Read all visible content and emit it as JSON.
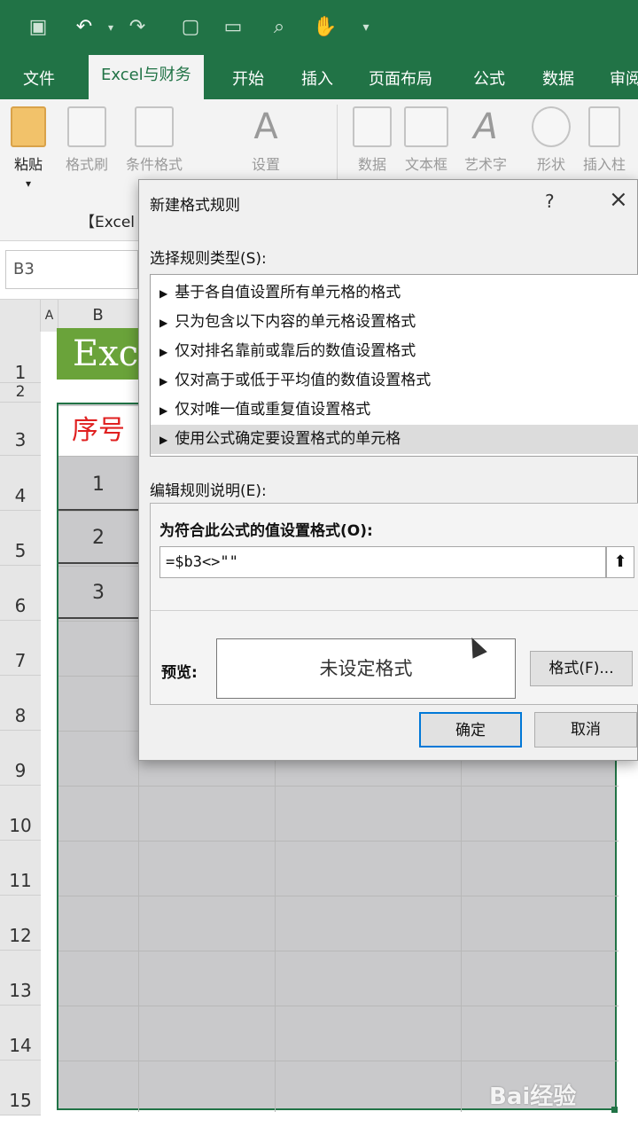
{
  "ribbon_tabs": [
    "文件",
    "Excel与财务",
    "开始",
    "插入",
    "页面布局",
    "公式",
    "数据",
    "审阅"
  ],
  "ribbon_buttons": {
    "paste": "粘贴",
    "format_painter": "格式刷",
    "conditional_format": "条件格式",
    "settings": "设置",
    "data": "数据",
    "textbox": "文本框",
    "wordart": "艺术字",
    "shapes": "形状",
    "insert_column": "插入柱",
    "group_label": "【Excel"
  },
  "name_box": "B3",
  "column_headers": [
    "A",
    "B"
  ],
  "row_headers": [
    "1",
    "2",
    "3",
    "4",
    "5",
    "6",
    "7",
    "8",
    "9",
    "10",
    "11",
    "12",
    "13",
    "14",
    "15"
  ],
  "sheet": {
    "title_cell": "Exc",
    "header_cell": "序号",
    "numbers": [
      "1",
      "2",
      "3"
    ]
  },
  "dialog": {
    "title": "新建格式规则",
    "help": "?",
    "close": "×",
    "select_rule_label": "选择规则类型(S):",
    "rules": [
      "基于各自值设置所有单元格的格式",
      "只为包含以下内容的单元格设置格式",
      "仅对排名靠前或靠后的数值设置格式",
      "仅对高于或低于平均值的数值设置格式",
      "仅对唯一值或重复值设置格式",
      "使用公式确定要设置格式的单元格"
    ],
    "selected_rule_index": 5,
    "edit_rule_label": "编辑规则说明(E):",
    "formula_label": "为符合此公式的值设置格式(O):",
    "formula_value": "=$b3<>\"\"",
    "preview_label": "预览:",
    "preview_text": "未设定格式",
    "format_button": "格式(F)...",
    "ok_button": "确定",
    "cancel_button": "取消"
  },
  "watermark": "Bai经验",
  "colors": {
    "excel_green": "#217346",
    "title_green": "#6aa33a",
    "header_red": "#e02020"
  }
}
